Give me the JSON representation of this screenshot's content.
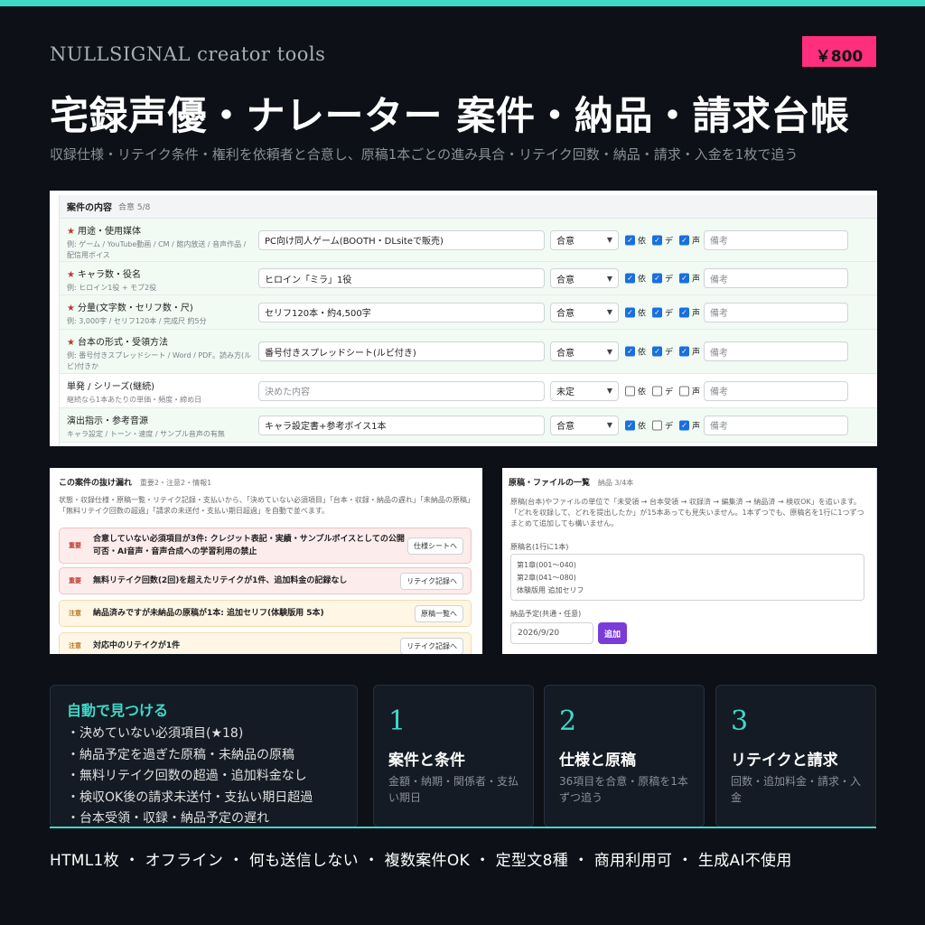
{
  "brand": "NULLSIGNAL  creator tools",
  "price": "￥800",
  "headline": "宅録声優・ナレーター 案件・納品・請求台帳",
  "subline": "収録仕様・リテイク条件・権利を依頼者と合意し、原稿1本ごとの進み具合・リテイク回数・納品・請求・入金を1枚で追う",
  "contract": {
    "title": "案件の内容",
    "progress": "合意 5/8",
    "check_labels": [
      "依",
      "デ",
      "声"
    ],
    "note_placeholder": "備考",
    "rows": [
      {
        "required": true,
        "title": "用途・使用媒体",
        "desc": "例: ゲーム / YouTube動画 / CM / 館内放送 / 音声作品 / 配信用ボイス",
        "value": "PC向け同人ゲーム(BOOTH・DLsiteで販売)",
        "status": "合意",
        "checks": [
          true,
          true,
          true
        ]
      },
      {
        "required": true,
        "title": "キャラ数・役名",
        "desc": "例: ヒロイン1役 + モブ2役",
        "value": "ヒロイン「ミラ」1役",
        "status": "合意",
        "checks": [
          true,
          true,
          true
        ]
      },
      {
        "required": true,
        "title": "分量(文字数・セリフ数・尺)",
        "desc": "例: 3,000字 / セリフ120本 / 完成尺 約5分",
        "value": "セリフ120本・約4,500字",
        "status": "合意",
        "checks": [
          true,
          true,
          true
        ]
      },
      {
        "required": true,
        "title": "台本の形式・受領方法",
        "desc": "例: 番号付きスプレッドシート / Word / PDF。読み方(ルビ)付きか",
        "value": "番号付きスプレッドシート(ルビ付き)",
        "status": "合意",
        "checks": [
          true,
          true,
          true
        ]
      },
      {
        "required": false,
        "title": "単発 / シリーズ(継続)",
        "desc": "継続なら1本あたりの単価・頻度・締め日",
        "value": "",
        "placeholder": "決めた内容",
        "status": "未定",
        "checks": [
          false,
          false,
          false
        ]
      },
      {
        "required": false,
        "title": "演出指示・参考音源",
        "desc": "キャラ設定 / トーン・速度 / サンプル音声の有無",
        "value": "キャラ設定書+参考ボイス1本",
        "status": "合意",
        "checks": [
          true,
          false,
          true
        ]
      }
    ]
  },
  "gaps": {
    "title": "この案件の抜け漏れ",
    "summary": "重要2・注意2・情報1",
    "desc": "状態・収録仕様・原稿一覧・リテイク記録・支払いから、「決めていない必須項目」「台本・収録・納品の遅れ」「未納品の原稿」「無料リテイク回数の超過」「請求の未送付・支払い期日超過」を自動で並べます。",
    "items": [
      {
        "level": "重要",
        "kind": "red",
        "text": "合意していない必須項目が3件: クレジット表記・実績・サンプルボイスとしての公開可否・AI音声・音声合成への学習利用の禁止",
        "button": "仕様シートへ"
      },
      {
        "level": "重要",
        "kind": "red",
        "text": "無料リテイク回数(2回)を超えたリテイクが1件、追加料金の記録なし",
        "button": "リテイク記録へ"
      },
      {
        "level": "注意",
        "kind": "yel",
        "text": "納品済みですが未納品の原稿が1本: 追加セリフ(体験版用 5本)",
        "button": "原稿一覧へ"
      },
      {
        "level": "注意",
        "kind": "yel",
        "text": "対応中のリテイクが1件",
        "button": "リテイク記録へ"
      }
    ]
  },
  "files": {
    "title": "原稿・ファイルの一覧",
    "summary": "納品 3/4本",
    "desc": "原稿(台本)やファイルの単位で「未受領 → 台本受領 → 収録済 → 編集済 → 納品済 → 検収OK」を追います。「どれを収録して、どれを提出したか」が15本あっても見失いません。1本ずつでも、原稿名を1行に1つずつまとめて追加しても構いません。",
    "names_label": "原稿名(1行に1本)",
    "names": [
      "第1章(001〜040)",
      "第2章(041〜080)",
      "体験版用 追加セリフ"
    ],
    "due_label": "納品予定(共通・任意)",
    "due_value": "2026/9/20",
    "add_button": "追加"
  },
  "auto": {
    "title": "自動で見つける",
    "items": [
      "・決めていない必須項目(★18)",
      "・納品予定を過ぎた原稿・未納品の原稿",
      "・無料リテイク回数の超過・追加料金なし",
      "・検収OK後の請求未送付・支払い期日超過",
      "・台本受領・収録・納品予定の遅れ"
    ]
  },
  "steps": [
    {
      "num": "1",
      "title": "案件と条件",
      "desc": "金額・納期・関係者・支払い期日"
    },
    {
      "num": "2",
      "title": "仕様と原稿",
      "desc": "36項目を合意・原稿を1本ずつ追う"
    },
    {
      "num": "3",
      "title": "リテイクと請求",
      "desc": "回数・追加料金・請求・入金"
    }
  ],
  "bottom": "HTML1枚 ・ オフライン ・ 何も送信しない ・ 複数案件OK ・ 定型文8種 ・ 商用利用可 ・ 生成AI不使用",
  "colors": {
    "accent": "#3fd9c8",
    "price_bg": "#ff2e7e",
    "bg": "#0d1117",
    "add_button": "#7a3bd8"
  }
}
